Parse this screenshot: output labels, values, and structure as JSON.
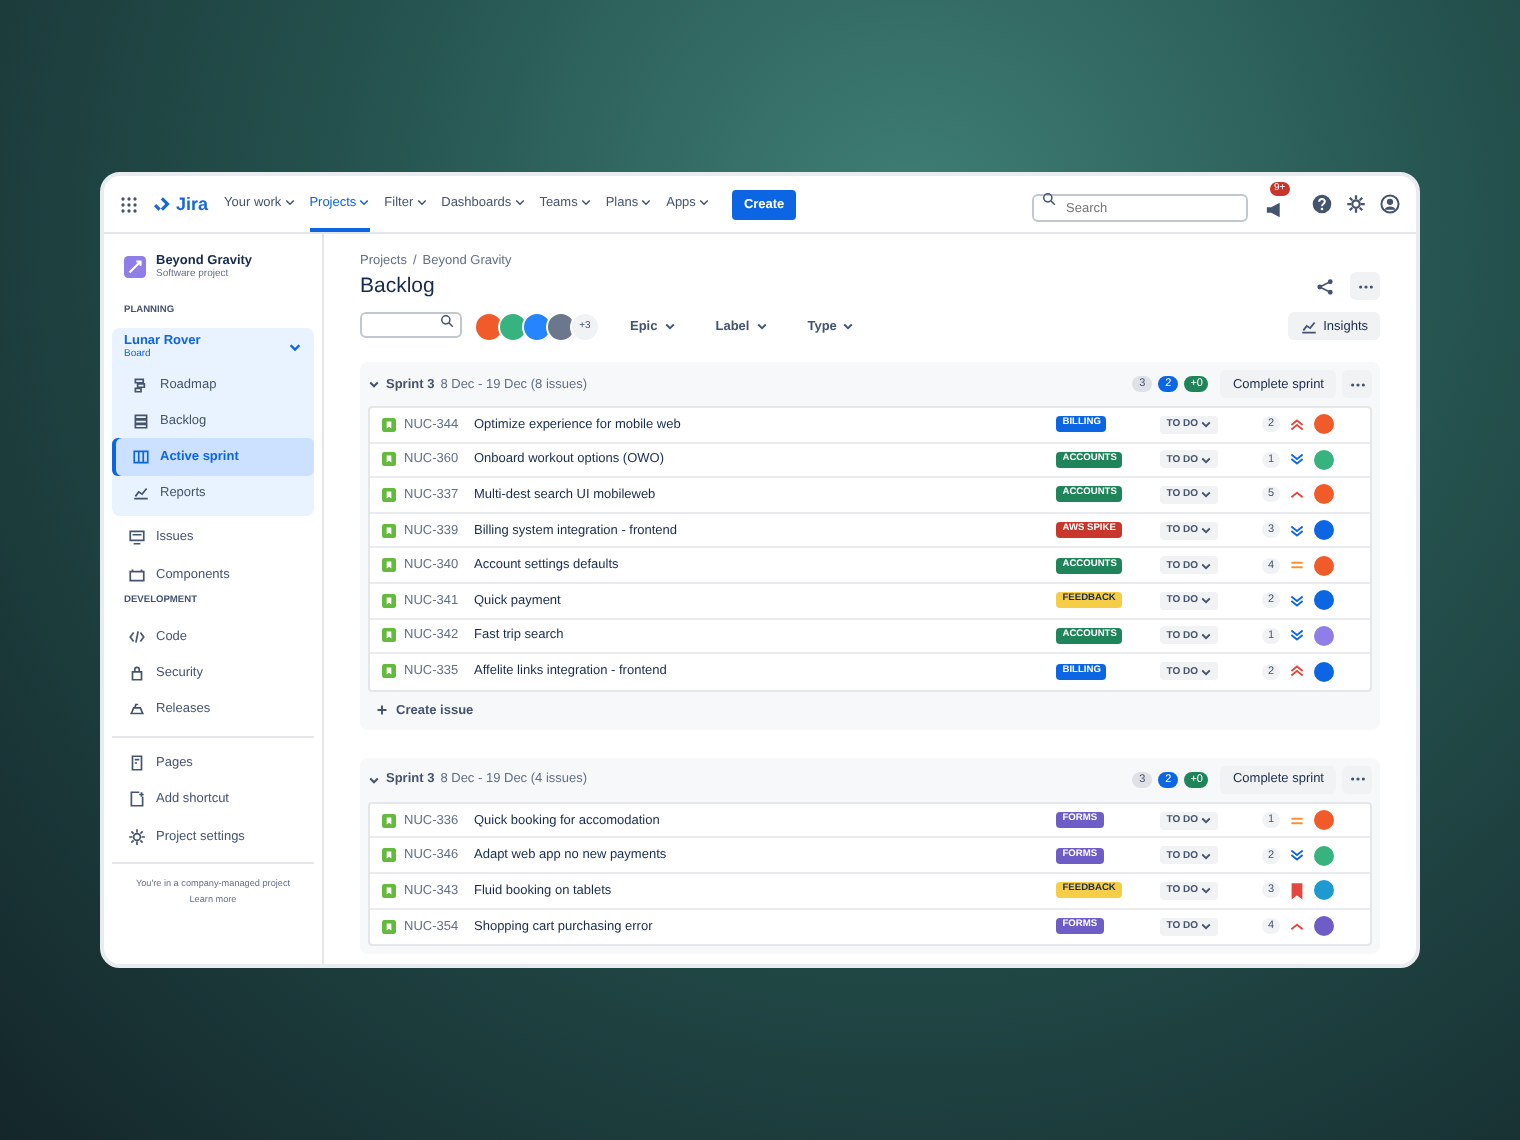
{
  "nav": {
    "product": "Jira",
    "items": [
      {
        "label": "Your work",
        "selected": false
      },
      {
        "label": "Projects",
        "selected": true
      },
      {
        "label": "Filter",
        "selected": false
      },
      {
        "label": "Dashboards",
        "selected": false
      },
      {
        "label": "Teams",
        "selected": false
      },
      {
        "label": "Plans",
        "selected": false
      },
      {
        "label": "Apps",
        "selected": false
      }
    ],
    "create": "Create",
    "search": {
      "placeholder": "Search"
    },
    "notifications_badge": "9+"
  },
  "sidebar": {
    "project": {
      "name": "Beyond Gravity",
      "type": "Software project"
    },
    "sections": [
      {
        "heading": "PLANNING",
        "board": {
          "name": "Lunar Rover",
          "type": "Board",
          "expanded": true,
          "children": [
            {
              "label": "Roadmap",
              "kind": "roadmap",
              "selected": false
            },
            {
              "label": "Backlog",
              "kind": "backlog",
              "selected": false
            },
            {
              "label": "Active sprint",
              "kind": "sprint",
              "selected": true
            },
            {
              "label": "Reports",
              "kind": "reports",
              "selected": false
            }
          ]
        },
        "items": [
          {
            "label": "Issues",
            "kind": "issues",
            "selected": false
          },
          {
            "label": "Components",
            "kind": "components",
            "selected": false
          }
        ]
      },
      {
        "heading": "DEVELOPMENT",
        "items": [
          {
            "label": "Code",
            "kind": "code",
            "selected": false
          },
          {
            "label": "Security",
            "kind": "security",
            "selected": false
          },
          {
            "label": "Releases",
            "kind": "releases",
            "selected": false
          }
        ]
      },
      {
        "items": [
          {
            "label": "Pages",
            "kind": "pages",
            "selected": false
          },
          {
            "label": "Add shortcut",
            "kind": "shortcut",
            "selected": false
          },
          {
            "label": "Project settings",
            "kind": "settings",
            "selected": false
          }
        ]
      }
    ],
    "footer": {
      "text": "You're in a company-managed project",
      "link": "Learn more"
    }
  },
  "breadcrumbs": {
    "separator": "/",
    "items": [
      "Projects",
      "Beyond Gravity"
    ]
  },
  "title": "Backlog",
  "avatars": [
    {
      "color": "#f15b2a"
    },
    {
      "color": "#36b37e"
    },
    {
      "color": "#2684ff"
    },
    {
      "color": "#6b778c"
    }
  ],
  "avatars_more": "+3",
  "filters": [
    "Epic",
    "Label",
    "Type"
  ],
  "insights": "Insights",
  "sprints": [
    {
      "name": "Sprint 3",
      "dates": "8 Dec - 19 Dec (8 issues)",
      "expanded": true,
      "counts": [
        {
          "value": "3",
          "kind": "todo"
        },
        {
          "value": "2",
          "kind": "progress"
        },
        {
          "value": "+0",
          "kind": "done"
        }
      ],
      "action": "Complete sprint",
      "create_issue": "Create issue",
      "issues": [
        {
          "key": "NUC-344",
          "summary": "Optimize experience for mobile web",
          "label": {
            "text": "BILLING",
            "color": "#0c66e4"
          },
          "status": "TO DO",
          "estimate": "2",
          "priority": {
            "kind": "highest"
          },
          "assignee": {
            "color": "#f15b2a"
          }
        },
        {
          "key": "NUC-360",
          "summary": "Onboard workout options (OWO)",
          "label": {
            "text": "ACCOUNTS",
            "color": "#1f845a"
          },
          "status": "TO DO",
          "estimate": "1",
          "priority": {
            "kind": "lowest"
          },
          "assignee": {
            "color": "#36b37e"
          }
        },
        {
          "key": "NUC-337",
          "summary": "Multi-dest search UI mobileweb",
          "label": {
            "text": "ACCOUNTS",
            "color": "#1f845a"
          },
          "status": "TO DO",
          "estimate": "5",
          "priority": {
            "kind": "high"
          },
          "assignee": {
            "color": "#f15b2a"
          }
        },
        {
          "key": "NUC-339",
          "summary": "Billing system integration - frontend",
          "label": {
            "text": "AWS SPIKE",
            "color": "#c9372c"
          },
          "status": "TO DO",
          "estimate": "3",
          "priority": {
            "kind": "lowest"
          },
          "assignee": {
            "color": "#0c66e4"
          }
        },
        {
          "key": "NUC-340",
          "summary": "Account settings defaults",
          "label": {
            "text": "ACCOUNTS",
            "color": "#1f845a"
          },
          "status": "TO DO",
          "estimate": "4",
          "priority": {
            "kind": "medium"
          },
          "assignee": {
            "color": "#f15b2a"
          }
        },
        {
          "key": "NUC-341",
          "summary": "Quick payment",
          "label": {
            "text": "FEEDBACK",
            "color": "#f5cd47"
          },
          "status": "TO DO",
          "estimate": "2",
          "priority": {
            "kind": "lowest"
          },
          "assignee": {
            "color": "#0c66e4"
          }
        },
        {
          "key": "NUC-342",
          "summary": "Fast trip search",
          "label": {
            "text": "ACCOUNTS",
            "color": "#1f845a"
          },
          "status": "TO DO",
          "estimate": "1",
          "priority": {
            "kind": "lowest"
          },
          "assignee": {
            "color": "#8f7ee7"
          }
        },
        {
          "key": "NUC-335",
          "summary": "Affelite links integration - frontend",
          "label": {
            "text": "BILLING",
            "color": "#0c66e4"
          },
          "status": "TO DO",
          "estimate": "2",
          "priority": {
            "kind": "highest"
          },
          "assignee": {
            "color": "#0c66e4"
          }
        }
      ]
    },
    {
      "name": "Sprint 3",
      "dates": "8 Dec - 19 Dec (4 issues)",
      "expanded": true,
      "counts": [
        {
          "value": "3",
          "kind": "todo"
        },
        {
          "value": "2",
          "kind": "progress"
        },
        {
          "value": "+0",
          "kind": "done"
        }
      ],
      "action": "Complete sprint",
      "issues": [
        {
          "key": "NUC-336",
          "summary": "Quick booking for accomodation",
          "label": {
            "text": "FORMS",
            "color": "#6e5dc6"
          },
          "status": "TO DO",
          "estimate": "1",
          "priority": {
            "kind": "medium"
          },
          "assignee": {
            "color": "#f15b2a"
          }
        },
        {
          "key": "NUC-346",
          "summary": "Adapt web app no new payments",
          "label": {
            "text": "FORMS",
            "color": "#6e5dc6"
          },
          "status": "TO DO",
          "estimate": "2",
          "priority": {
            "kind": "lowest"
          },
          "assignee": {
            "color": "#36b37e"
          }
        },
        {
          "key": "NUC-343",
          "summary": "Fluid booking on tablets",
          "label": {
            "text": "FEEDBACK",
            "color": "#f5cd47"
          },
          "status": "TO DO",
          "estimate": "3",
          "priority": {
            "kind": "blocker"
          },
          "assignee": {
            "color": "#1d9bd1"
          }
        },
        {
          "key": "NUC-354",
          "summary": "Shopping cart purchasing error",
          "label": {
            "text": "FORMS",
            "color": "#6e5dc6"
          },
          "status": "TO DO",
          "estimate": "4",
          "priority": {
            "kind": "high"
          },
          "assignee": {
            "color": "#6e5dc6"
          }
        }
      ]
    }
  ]
}
